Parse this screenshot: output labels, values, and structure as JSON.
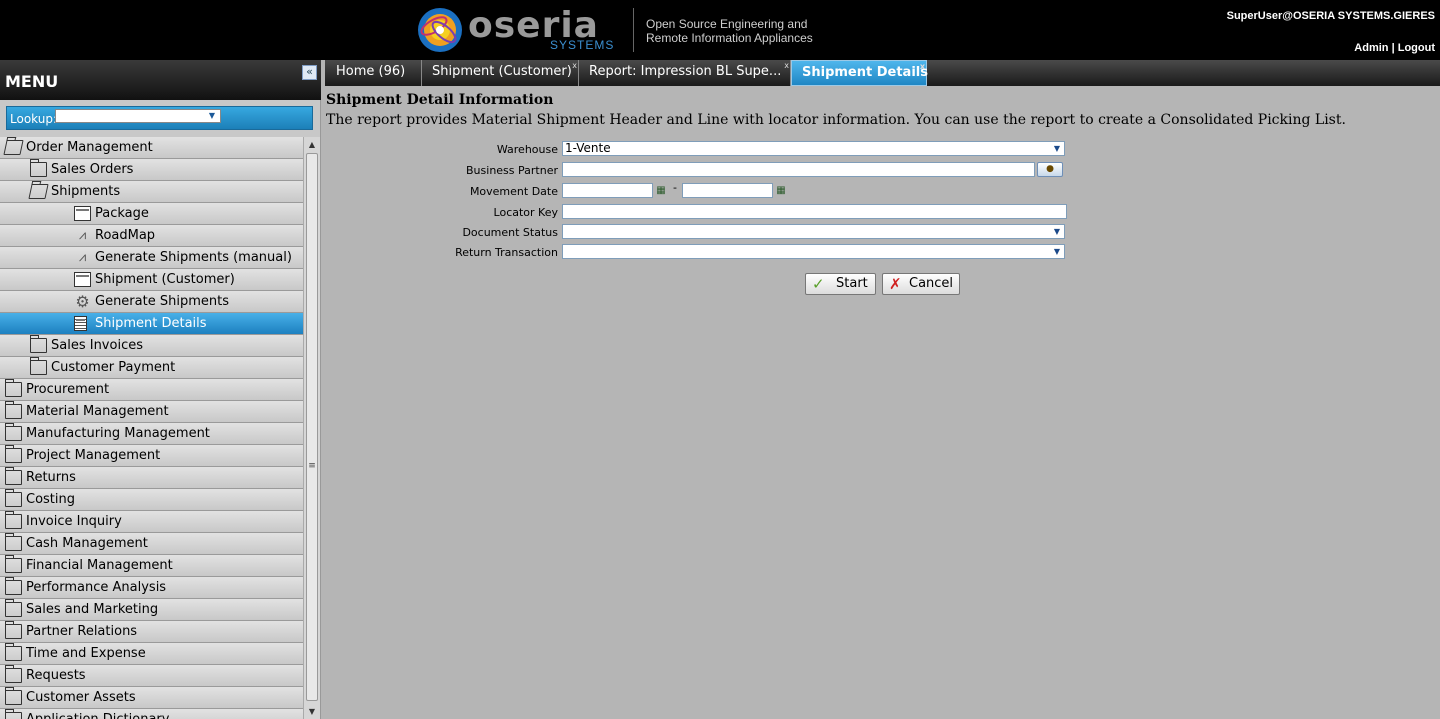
{
  "header": {
    "logo_word": "oseria",
    "logo_sub": "SYSTEMS",
    "tagline_line1": "Open Source Engineering and",
    "tagline_line2": "Remote Information Appliances",
    "user": "SuperUser@OSERIA SYSTEMS.GIERES",
    "admin_link": "Admin",
    "logout_link": "Logout",
    "separator": "|"
  },
  "sidebar": {
    "title": "MENU",
    "collapse_glyph": "«",
    "lookup_label": "Lookup:",
    "lookup_value": "",
    "tree": [
      {
        "label": "Order Management",
        "icon": "folder-open-icon",
        "indent": 0
      },
      {
        "label": "Sales Orders",
        "icon": "folder-icon",
        "indent": 1
      },
      {
        "label": "Shipments",
        "icon": "folder-open-icon",
        "indent": 1
      },
      {
        "label": "Package",
        "icon": "window-icon",
        "indent": 3
      },
      {
        "label": "RoadMap",
        "icon": "workflow-icon",
        "indent": 3
      },
      {
        "label": "Generate Shipments (manual)",
        "icon": "workflow-icon",
        "indent": 3
      },
      {
        "label": "Shipment (Customer)",
        "icon": "window-icon",
        "indent": 3
      },
      {
        "label": "Generate Shipments",
        "icon": "gear-icon",
        "indent": 3
      },
      {
        "label": "Shipment Details",
        "icon": "report-icon",
        "indent": 3,
        "selected": true
      },
      {
        "label": "Sales Invoices",
        "icon": "folder-icon",
        "indent": 1
      },
      {
        "label": "Customer Payment",
        "icon": "folder-icon",
        "indent": 1
      },
      {
        "label": "Procurement",
        "icon": "folder-icon",
        "indent": 0
      },
      {
        "label": "Material Management",
        "icon": "folder-icon",
        "indent": 0
      },
      {
        "label": "Manufacturing Management",
        "icon": "folder-icon",
        "indent": 0
      },
      {
        "label": "Project Management",
        "icon": "folder-icon",
        "indent": 0
      },
      {
        "label": "Returns",
        "icon": "folder-icon",
        "indent": 0
      },
      {
        "label": "Costing",
        "icon": "folder-icon",
        "indent": 0
      },
      {
        "label": "Invoice Inquiry",
        "icon": "folder-icon",
        "indent": 0
      },
      {
        "label": "Cash Management",
        "icon": "folder-icon",
        "indent": 0
      },
      {
        "label": "Financial Management",
        "icon": "folder-icon",
        "indent": 0
      },
      {
        "label": "Performance Analysis",
        "icon": "folder-icon",
        "indent": 0
      },
      {
        "label": "Sales and Marketing",
        "icon": "folder-icon",
        "indent": 0
      },
      {
        "label": "Partner Relations",
        "icon": "folder-icon",
        "indent": 0
      },
      {
        "label": "Time and Expense",
        "icon": "folder-icon",
        "indent": 0
      },
      {
        "label": "Requests",
        "icon": "folder-icon",
        "indent": 0
      },
      {
        "label": "Customer Assets",
        "icon": "folder-icon",
        "indent": 0
      },
      {
        "label": "Application Dictionary",
        "icon": "folder-icon",
        "indent": 0
      }
    ]
  },
  "tabs": [
    {
      "label": "Home (96)",
      "closable": false,
      "active": false
    },
    {
      "label": "Shipment (Customer)",
      "closable": true,
      "active": false
    },
    {
      "label": "Report: Impression BL Supe...",
      "closable": true,
      "active": false
    },
    {
      "label": "Shipment Details",
      "closable": true,
      "active": true
    }
  ],
  "content": {
    "title": "Shipment Detail Information",
    "description": "The report provides Material Shipment Header and Line with locator information. You can use the report to create a Consolidated Picking List.",
    "fields": {
      "warehouse_label": "Warehouse",
      "warehouse_value": "1-Vente",
      "business_partner_label": "Business Partner",
      "business_partner_value": "",
      "movement_date_label": "Movement Date",
      "movement_date_from": "",
      "movement_date_to": "",
      "date_separator": "-",
      "locator_key_label": "Locator Key",
      "locator_key_value": "",
      "document_status_label": "Document Status",
      "document_status_value": "",
      "return_transaction_label": "Return Transaction",
      "return_transaction_value": ""
    },
    "start_label": "Start",
    "cancel_label": "Cancel"
  },
  "colors": {
    "accent": "#2a92d0",
    "header_bg": "#000000",
    "content_bg": "#b5b5b5"
  }
}
